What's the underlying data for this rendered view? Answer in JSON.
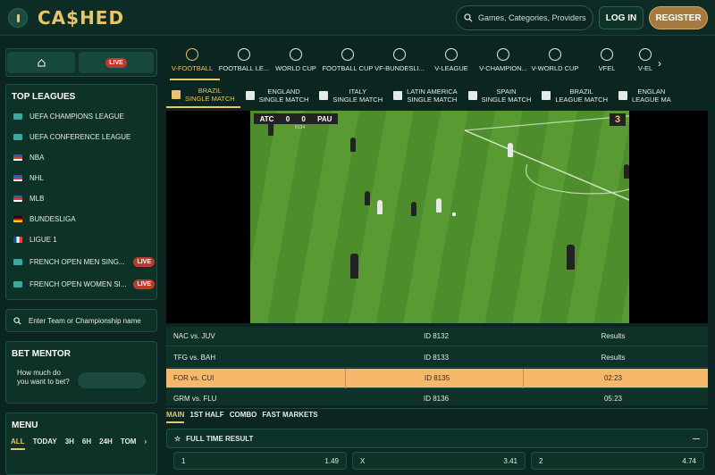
{
  "brand": {
    "logo_text": "CA$HED",
    "accent": "#e9c46a"
  },
  "header": {
    "search_placeholder": "Games, Categories, Providers",
    "login_label": "LOG IN",
    "register_label": "REGISTER"
  },
  "sidebar": {
    "live_label": "LIVE",
    "top_leagues_title": "TOP LEAGUES",
    "leagues": [
      {
        "name": "UEFA CHAMPIONS LEAGUE",
        "live": false
      },
      {
        "name": "UEFA CONFERENCE LEAGUE",
        "live": false
      },
      {
        "name": "NBA",
        "live": false
      },
      {
        "name": "NHL",
        "live": false
      },
      {
        "name": "MLB",
        "live": false
      },
      {
        "name": "BUNDESLIGA",
        "live": false
      },
      {
        "name": "LIGUE 1",
        "live": false
      },
      {
        "name": "FRENCH OPEN MEN SING...",
        "live": true,
        "badge": "LIVE"
      },
      {
        "name": "FRENCH OPEN WOMEN SI...",
        "live": true,
        "badge": "LIVE"
      }
    ],
    "team_search_placeholder": "Enter Team or Championship name",
    "bet_mentor": {
      "title": "BET MENTOR",
      "question": "How much do you want to bet?"
    },
    "menu": {
      "title": "MENU",
      "tabs": [
        "ALL",
        "TODAY",
        "3H",
        "6H",
        "24H",
        "TOM"
      ]
    }
  },
  "sports_tabs": [
    "V-FOOTBALL",
    "FOOTBALL LE...",
    "WORLD CUP",
    "FOOTBALL CUP",
    "VF-BUNDESLI...",
    "V-LEAGUE",
    "V-CHAMPION...",
    "V-WORLD CUP",
    "VFEL",
    "V-EL"
  ],
  "competition_tabs": [
    {
      "line1": "BRAZIL",
      "line2": "SINGLE MATCH"
    },
    {
      "line1": "ENGLAND",
      "line2": "SINGLE MATCH"
    },
    {
      "line1": "ITALY",
      "line2": "SINGLE MATCH"
    },
    {
      "line1": "LATIN AMERICA",
      "line2": "SINGLE MATCH"
    },
    {
      "line1": "SPAIN",
      "line2": "SINGLE MATCH"
    },
    {
      "line1": "BRAZIL",
      "line2": "LEAGUE MATCH"
    },
    {
      "line1": "ENGLAN",
      "line2": "LEAGUE MA"
    }
  ],
  "video": {
    "home": "ATC",
    "away": "PAU",
    "home_score": "0",
    "away_score": "0",
    "match_id": "8134",
    "clock": "3"
  },
  "events": [
    {
      "match": "NAC vs. JUV",
      "id": "ID 8132",
      "status": "Results"
    },
    {
      "match": "TFG vs. BAH",
      "id": "ID 8133",
      "status": "Results"
    },
    {
      "match": "FOR vs. CUI",
      "id": "ID 8135",
      "status": "02:23"
    },
    {
      "match": "GRM vs. FLU",
      "id": "ID 8136",
      "status": "05:23"
    }
  ],
  "market_tabs": [
    "MAIN",
    "1ST HALF",
    "COMBO",
    "FAST MARKETS"
  ],
  "full_time_result": {
    "title": "FULL TIME RESULT",
    "odds": [
      {
        "label": "1",
        "value": "1.49"
      },
      {
        "label": "X",
        "value": "3.41"
      },
      {
        "label": "2",
        "value": "4.74"
      }
    ]
  }
}
